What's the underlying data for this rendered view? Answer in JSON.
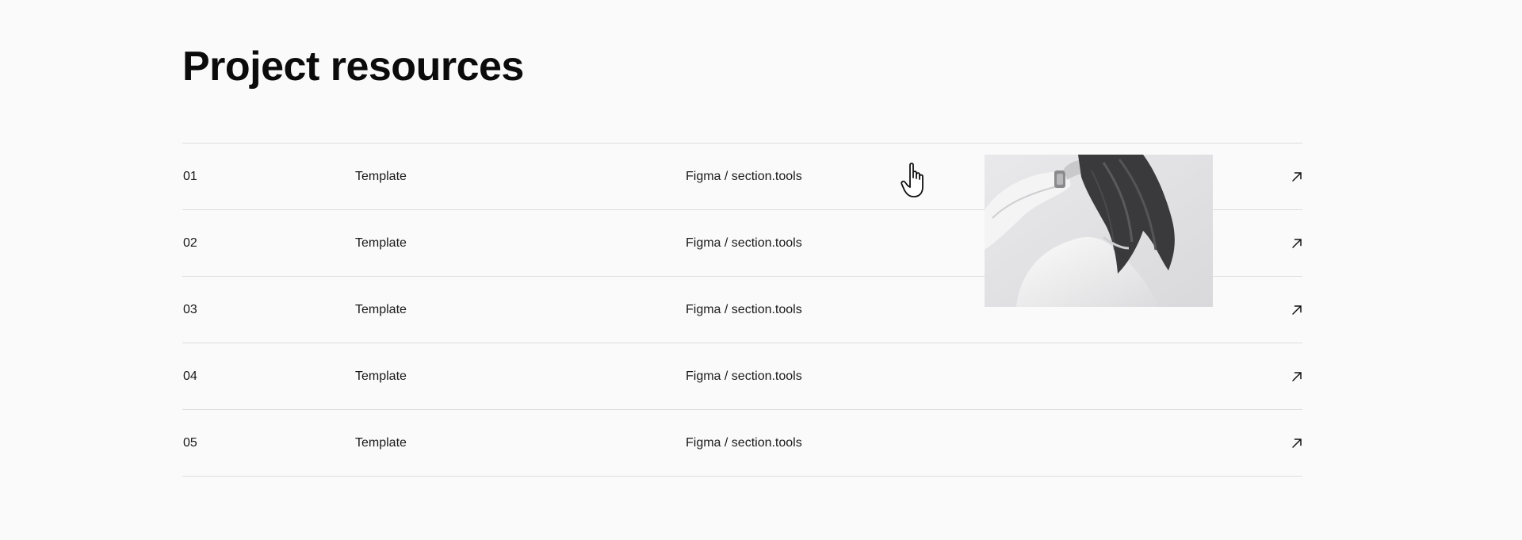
{
  "page": {
    "title": "Project resources"
  },
  "resources": [
    {
      "number": "01",
      "type": "Template",
      "source": "Figma / section.tools"
    },
    {
      "number": "02",
      "type": "Template",
      "source": "Figma / section.tools"
    },
    {
      "number": "03",
      "type": "Template",
      "source": "Figma / section.tools"
    },
    {
      "number": "04",
      "type": "Template",
      "source": "Figma / section.tools"
    },
    {
      "number": "05",
      "type": "Template",
      "source": "Figma / section.tools"
    }
  ],
  "icons": {
    "row_link": "arrow-up-right-icon",
    "cursor": "hand-pointer-icon"
  },
  "colors": {
    "background": "#fafafa",
    "text": "#111111",
    "divider": "#dedede"
  }
}
